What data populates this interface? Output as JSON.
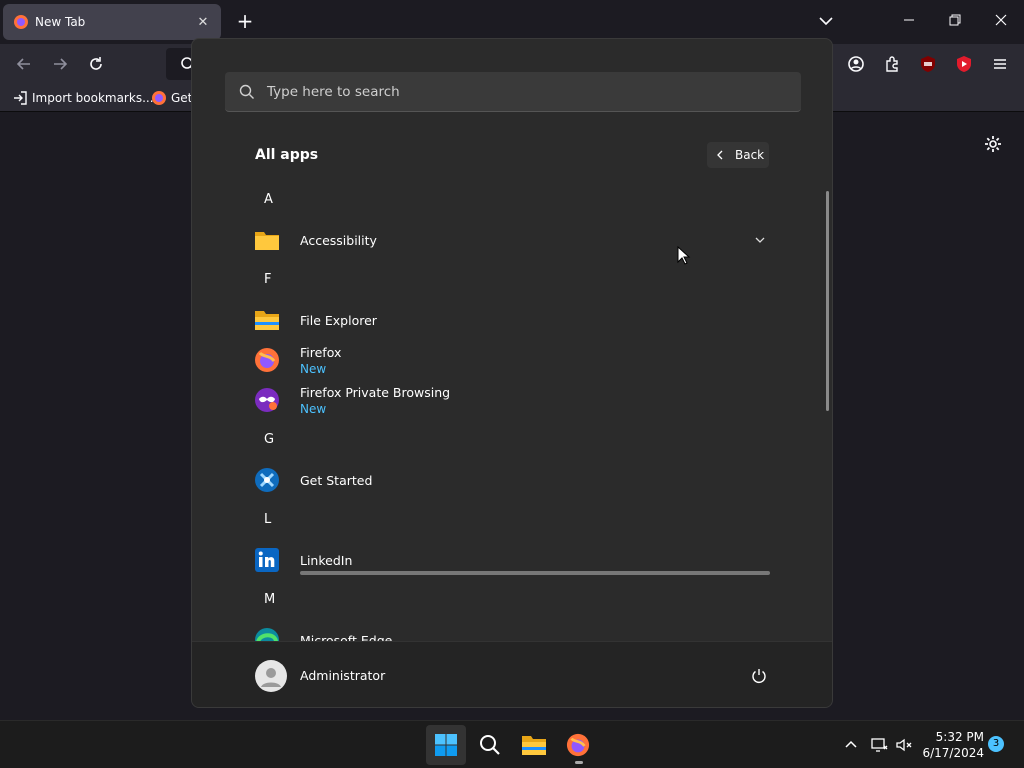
{
  "browser": {
    "tab_title": "New Tab",
    "tab_close": "✕",
    "new_tab": "+",
    "bookmarks": [
      {
        "label": "Import bookmarks..."
      },
      {
        "label": "Gett"
      }
    ]
  },
  "start_menu": {
    "search_placeholder": "Type here to search",
    "title": "All apps",
    "back_label": "Back",
    "letters": [
      "A",
      "F",
      "G",
      "L",
      "M"
    ],
    "apps": [
      {
        "name": "Accessibility",
        "icon": "folder-icon"
      },
      {
        "name": "File Explorer",
        "icon": "file-explorer-icon"
      },
      {
        "name": "Firefox",
        "sub": "New",
        "icon": "firefox-icon"
      },
      {
        "name": "Firefox Private Browsing",
        "sub": "New",
        "icon": "firefox-private-icon"
      },
      {
        "name": "Get Started",
        "icon": "get-started-icon"
      },
      {
        "name": "LinkedIn",
        "icon": "linkedin-icon"
      },
      {
        "name": "Microsoft Edge",
        "icon": "edge-icon"
      }
    ],
    "user": "Administrator"
  },
  "taskbar": {
    "time": "5:32 PM",
    "date": "6/17/2024",
    "notification_count": "3"
  },
  "colors": {
    "accent": "#4cc2ff",
    "menu_bg": "#2b2b2b",
    "browser_bg": "#1c1b22"
  }
}
